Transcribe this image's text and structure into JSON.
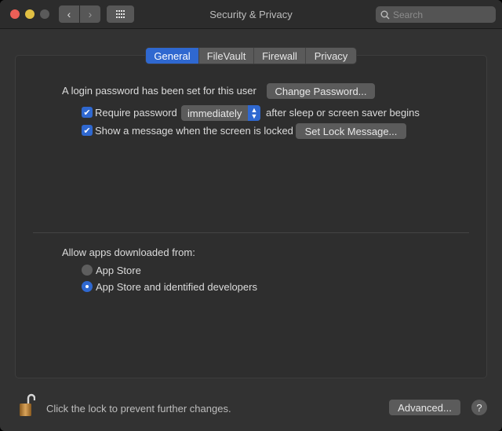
{
  "window": {
    "title": "Security & Privacy"
  },
  "toolbar": {
    "back": "‹",
    "forward": "›",
    "search_placeholder": "Search"
  },
  "tabs": [
    {
      "label": "General",
      "active": true
    },
    {
      "label": "FileVault"
    },
    {
      "label": "Firewall"
    },
    {
      "label": "Privacy"
    }
  ],
  "general": {
    "login_text": "A login password has been set for this user",
    "change_password": "Change Password...",
    "require_password_label": "Require password",
    "require_password_checked": true,
    "require_password_delay": "immediately",
    "after_sleep_text": "after sleep or screen saver begins",
    "show_message_label": "Show a message when the screen is locked",
    "show_message_checked": true,
    "set_lock_message": "Set Lock Message...",
    "allow_apps_label": "Allow apps downloaded from:",
    "options": [
      {
        "label": "App Store",
        "selected": false
      },
      {
        "label": "App Store and identified developers",
        "selected": true
      }
    ]
  },
  "footer": {
    "lock_text": "Click the lock to prevent further changes.",
    "advanced": "Advanced...",
    "help": "?"
  },
  "colors": {
    "accent": "#2f68d0",
    "close": "#ec5f57",
    "minimize": "#e1c043"
  }
}
